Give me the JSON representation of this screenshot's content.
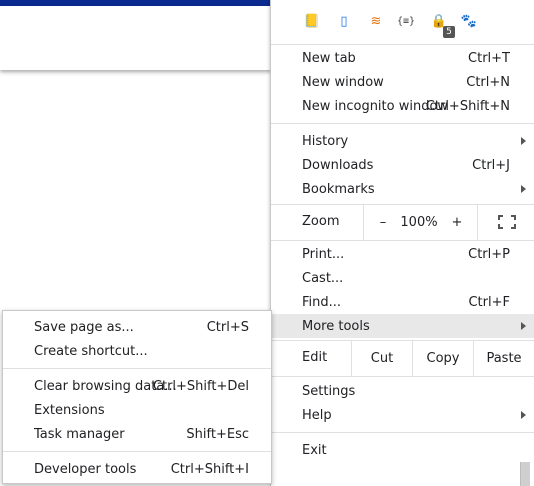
{
  "extensions": [
    {
      "icon": "note-book-icon",
      "glyph": "📒"
    },
    {
      "icon": "pinned-bookmark-icon",
      "glyph": "▯"
    },
    {
      "icon": "rss-feed-icon",
      "glyph": "≋"
    },
    {
      "icon": "json-formatter-icon",
      "glyph": "{≡}"
    },
    {
      "icon": "lock-extension-icon",
      "glyph": "🔒",
      "badge": "5"
    },
    {
      "icon": "gnome-foot-icon",
      "glyph": "🐾"
    }
  ],
  "menu": {
    "new_tab": {
      "label": "New tab",
      "shortcut": "Ctrl+T"
    },
    "new_window": {
      "label": "New window",
      "shortcut": "Ctrl+N"
    },
    "new_incognito": {
      "label": "New incognito window",
      "shortcut": "Ctrl+Shift+N"
    },
    "history": {
      "label": "History"
    },
    "downloads": {
      "label": "Downloads",
      "shortcut": "Ctrl+J"
    },
    "bookmarks": {
      "label": "Bookmarks"
    },
    "zoom": {
      "label": "Zoom",
      "minus": "–",
      "value": "100%",
      "plus": "+"
    },
    "print": {
      "label": "Print...",
      "shortcut": "Ctrl+P"
    },
    "cast": {
      "label": "Cast..."
    },
    "find": {
      "label": "Find...",
      "shortcut": "Ctrl+F"
    },
    "more_tools": {
      "label": "More tools"
    },
    "edit": {
      "label": "Edit",
      "cut": "Cut",
      "copy": "Copy",
      "paste": "Paste"
    },
    "settings": {
      "label": "Settings"
    },
    "help": {
      "label": "Help"
    },
    "exit": {
      "label": "Exit"
    }
  },
  "submenu": {
    "save_page": {
      "label": "Save page as...",
      "shortcut": "Ctrl+S"
    },
    "create_shortcut": {
      "label": "Create shortcut..."
    },
    "clear_browsing": {
      "label": "Clear browsing data...",
      "shortcut": "Ctrl+Shift+Del"
    },
    "extensions": {
      "label": "Extensions"
    },
    "task_manager": {
      "label": "Task manager",
      "shortcut": "Shift+Esc"
    },
    "developer_tools": {
      "label": "Developer tools",
      "shortcut": "Ctrl+Shift+I"
    }
  }
}
